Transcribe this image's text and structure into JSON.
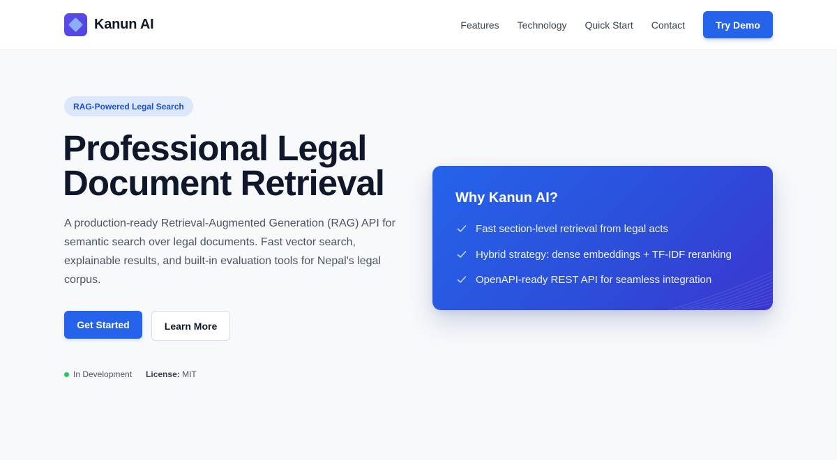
{
  "header": {
    "brand": "Kanun AI",
    "logo_icon": "diamond-logo-icon",
    "nav": [
      "Features",
      "Technology",
      "Quick Start",
      "Contact"
    ],
    "cta": "Try Demo"
  },
  "hero": {
    "badge": "RAG-Powered Legal Search",
    "title_line1": "Professional Legal",
    "title_line2": "Document Retrieval",
    "description": "A production-ready Retrieval-Augmented Generation (RAG) API for semantic search over legal documents. Fast vector search, explainable results, and built-in evaluation tools for Nepal's legal corpus.",
    "primary_button": "Get Started",
    "secondary_button": "Learn More",
    "status": "In Development",
    "license_label": "License:",
    "license_value": "MIT"
  },
  "card": {
    "title": "Why Kanun AI?",
    "features": [
      "Fast section-level retrieval from legal acts",
      "Hybrid strategy: dense embeddings + TF-IDF reranking",
      "OpenAPI-ready REST API for seamless integration"
    ],
    "check_icon": "check-icon"
  },
  "colors": {
    "accent": "#2563eb",
    "status_green": "#22c55e",
    "badge_bg": "#dbe7fb",
    "card_gradient_end": "#3a36cf"
  }
}
